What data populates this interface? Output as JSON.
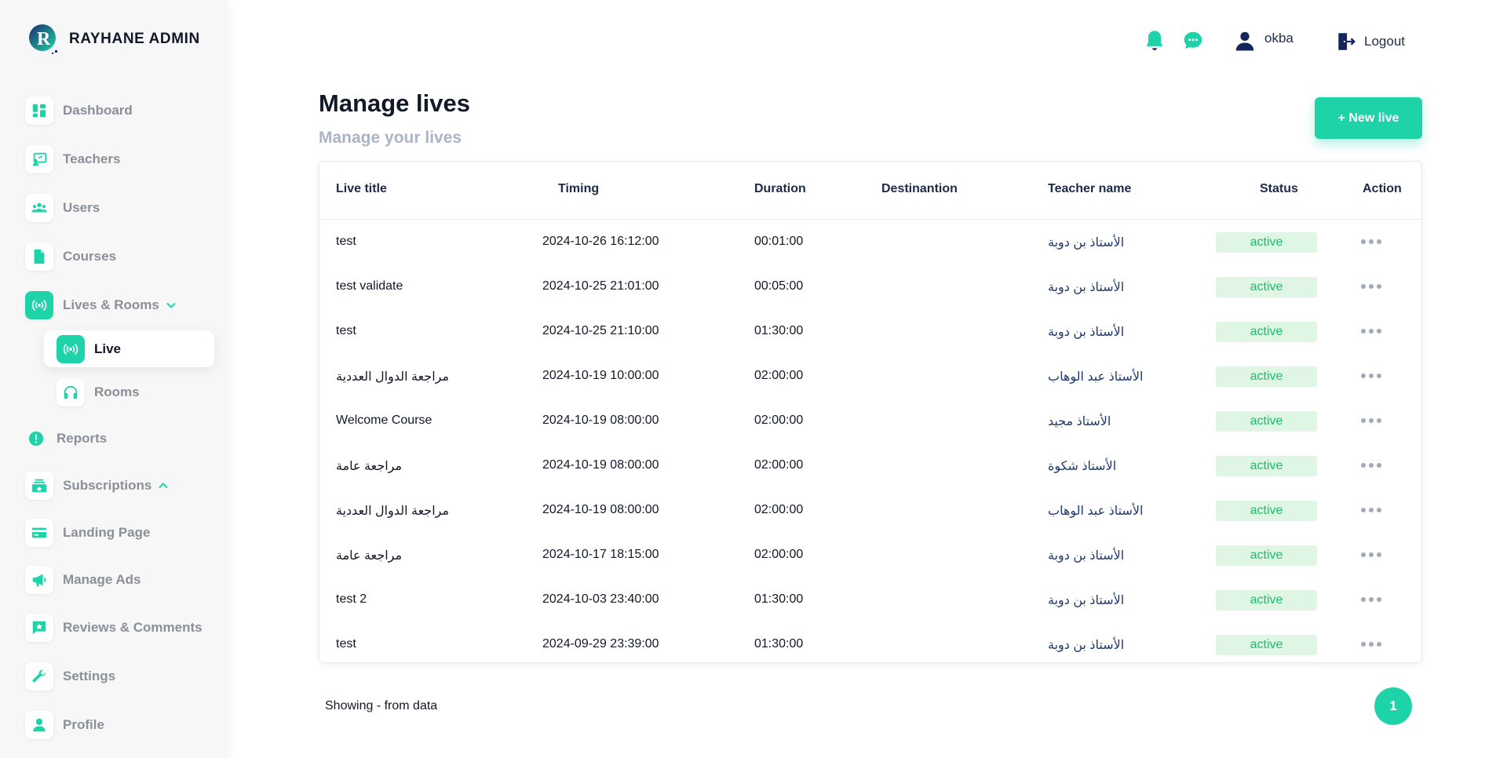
{
  "brand": {
    "name": "RAYHANE ADMIN",
    "logo_letter": "R"
  },
  "colors": {
    "accent": "#1fd3a8",
    "status_bg": "#dff6e5",
    "status_text": "#18c06a",
    "navy": "#1e2a4a"
  },
  "sidebar": {
    "items": [
      {
        "label": "Dashboard",
        "icon": "dashboard-icon"
      },
      {
        "label": "Teachers",
        "icon": "teacher-board-icon"
      },
      {
        "label": "Users",
        "icon": "users-icon"
      },
      {
        "label": "Courses",
        "icon": "document-icon"
      },
      {
        "label": "Lives & Rooms",
        "icon": "broadcast-icon",
        "expanded": true
      },
      {
        "label": "Reports",
        "icon": "alert-circle-icon"
      },
      {
        "label": "Subscriptions",
        "icon": "subscriptions-icon"
      },
      {
        "label": "Landing Page",
        "icon": "credit-card-icon"
      },
      {
        "label": "Manage Ads",
        "icon": "megaphone-icon"
      },
      {
        "label": "Reviews & Comments",
        "icon": "review-star-icon"
      },
      {
        "label": "Settings",
        "icon": "wrench-icon"
      },
      {
        "label": "Profile",
        "icon": "person-icon"
      }
    ],
    "subitems": [
      {
        "label": "Live",
        "icon": "broadcast-icon",
        "active": true
      },
      {
        "label": "Rooms",
        "icon": "headphones-icon"
      }
    ]
  },
  "topbar": {
    "username": "okba",
    "logout": "Logout"
  },
  "page": {
    "title": "Manage lives",
    "subtitle": "Manage your lives",
    "new_button": "+ New live"
  },
  "table": {
    "headers": [
      "Live title",
      "Timing",
      "Duration",
      "Destinantion",
      "Teacher name",
      "Status",
      "Action"
    ],
    "rows": [
      {
        "title": "test",
        "timing": "2024-10-26 16:12:00",
        "duration": "00:01:00",
        "destination": "",
        "teacher": "الأستاذ بن دوبة",
        "status": "active"
      },
      {
        "title": "test validate",
        "timing": "2024-10-25 21:01:00",
        "duration": "00:05:00",
        "destination": "",
        "teacher": "الأستاذ بن دوبة",
        "status": "active"
      },
      {
        "title": "test",
        "timing": "2024-10-25 21:10:00",
        "duration": "01:30:00",
        "destination": "",
        "teacher": "الأستاذ بن دوبة",
        "status": "active"
      },
      {
        "title": "مراجعة الدوال العددية",
        "timing": "2024-10-19 10:00:00",
        "duration": "02:00:00",
        "destination": "",
        "teacher": "الأستاذ عبد الوهاب",
        "status": "active"
      },
      {
        "title": "Welcome Course",
        "timing": "2024-10-19 08:00:00",
        "duration": "02:00:00",
        "destination": "",
        "teacher": "الأستاذ مجيد",
        "status": "active"
      },
      {
        "title": "مراجعة عامة",
        "timing": "2024-10-19 08:00:00",
        "duration": "02:00:00",
        "destination": "",
        "teacher": "الأستاذ شكوة",
        "status": "active"
      },
      {
        "title": "مراجعة الدوال العددية",
        "timing": "2024-10-19 08:00:00",
        "duration": "02:00:00",
        "destination": "",
        "teacher": "الأستاذ عبد الوهاب",
        "status": "active"
      },
      {
        "title": "مراجعة عامة",
        "timing": "2024-10-17 18:15:00",
        "duration": "02:00:00",
        "destination": "",
        "teacher": "الأستاذ بن دوبة",
        "status": "active"
      },
      {
        "title": "test 2",
        "timing": "2024-10-03 23:40:00",
        "duration": "01:30:00",
        "destination": "",
        "teacher": "الأستاذ بن دوبة",
        "status": "active"
      },
      {
        "title": "test",
        "timing": "2024-09-29 23:39:00",
        "duration": "01:30:00",
        "destination": "",
        "teacher": "الأستاذ بن دوبة",
        "status": "active"
      }
    ]
  },
  "footer": {
    "showing": "Showing - from data",
    "page": "1"
  }
}
